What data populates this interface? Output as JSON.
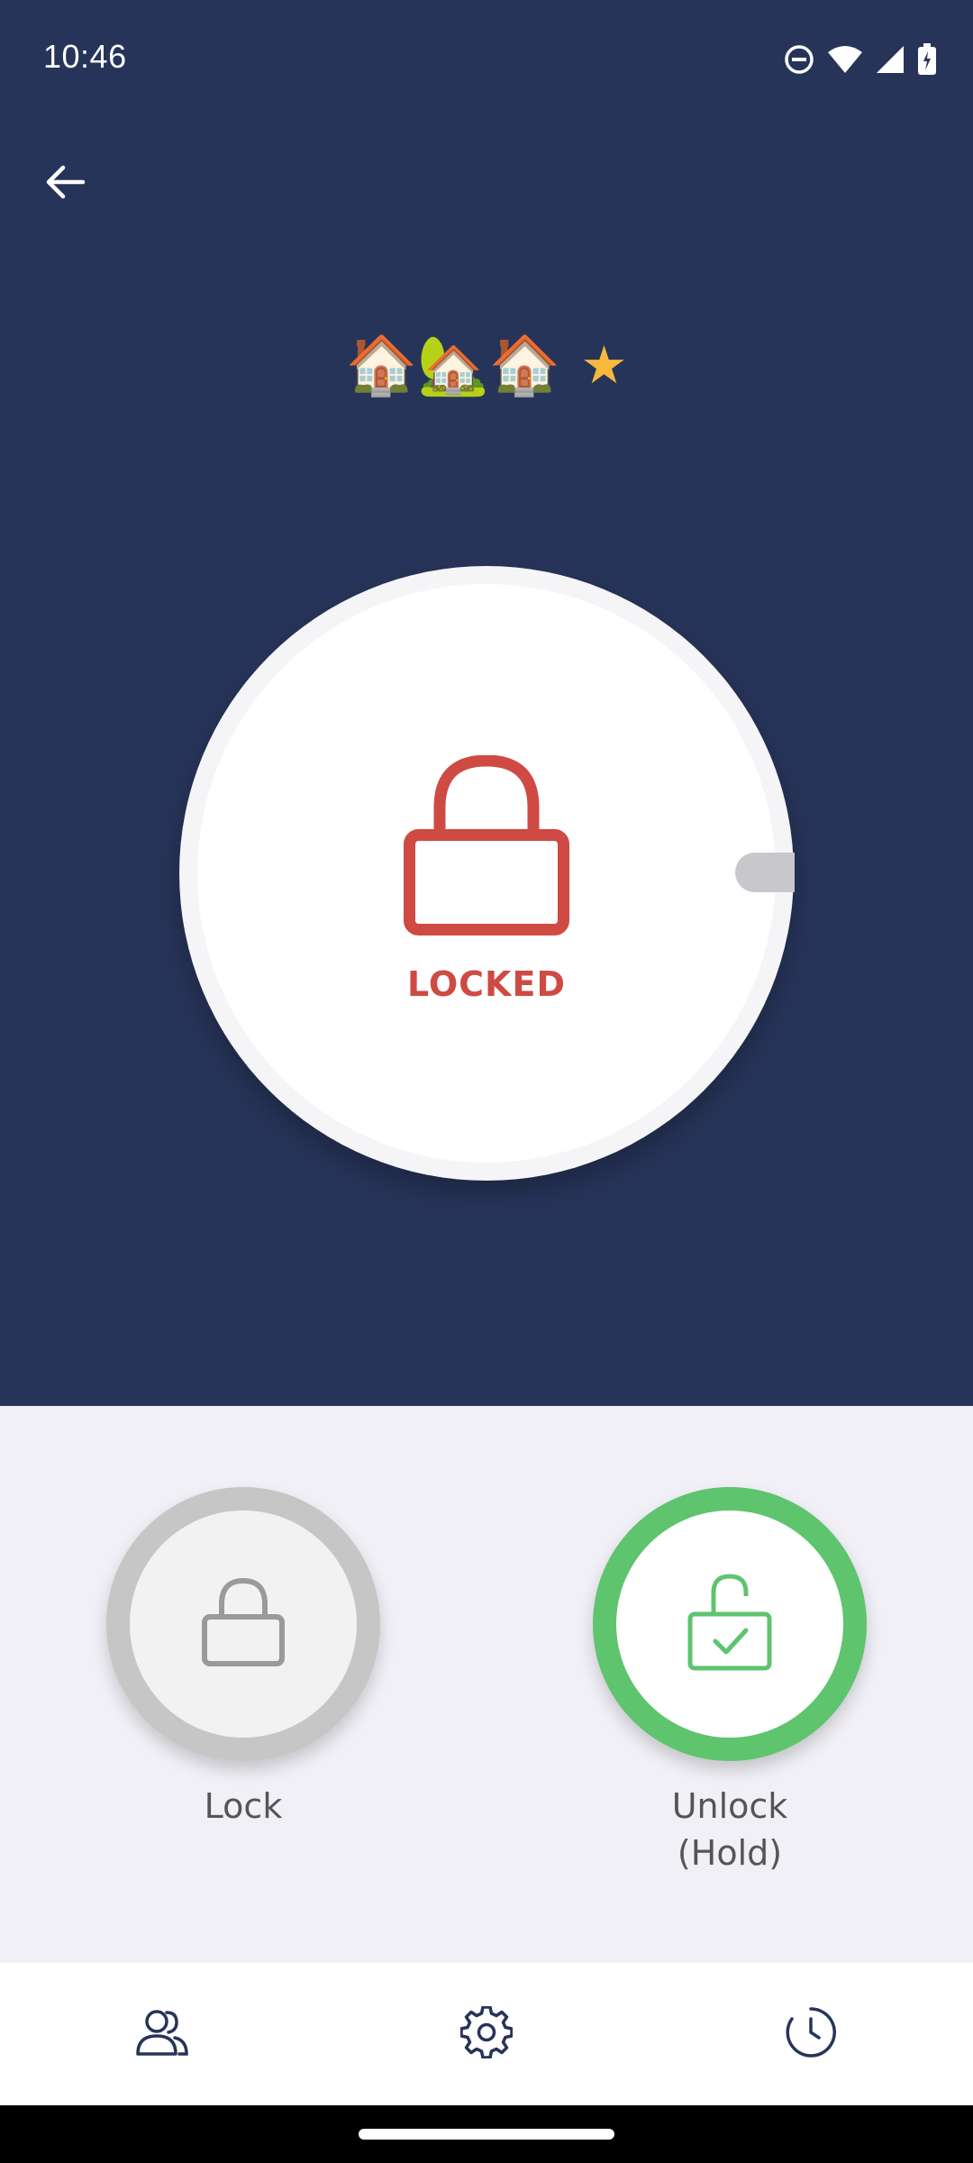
{
  "status_bar": {
    "time": "10:46",
    "icons": [
      "do-not-disturb-icon",
      "wifi-icon",
      "cellular-signal-icon",
      "battery-charging-icon"
    ]
  },
  "header": {
    "back_icon": "arrow-left-icon",
    "title_emojis": "🏠🏡🏠",
    "favorite_icon": "star-icon",
    "favorite_glyph": "★"
  },
  "lock_status": {
    "icon": "padlock-closed-icon",
    "label": "LOCKED",
    "color": "#CF4A42"
  },
  "actions": {
    "lock": {
      "label": "Lock",
      "icon": "padlock-icon"
    },
    "unlock": {
      "label": "Unlock\n(Hold)",
      "icon": "padlock-open-check-icon",
      "color": "#5EC46E"
    }
  },
  "bottom_nav": {
    "items": [
      {
        "name": "users",
        "icon": "users-icon"
      },
      {
        "name": "settings",
        "icon": "gear-icon"
      },
      {
        "name": "history",
        "icon": "clock-icon"
      }
    ]
  },
  "colors": {
    "header_bg": "#273459",
    "page_bg": "#F0F0F6",
    "accent_red": "#CF4A42",
    "accent_green": "#5EC46E",
    "star": "#F6B93B"
  }
}
